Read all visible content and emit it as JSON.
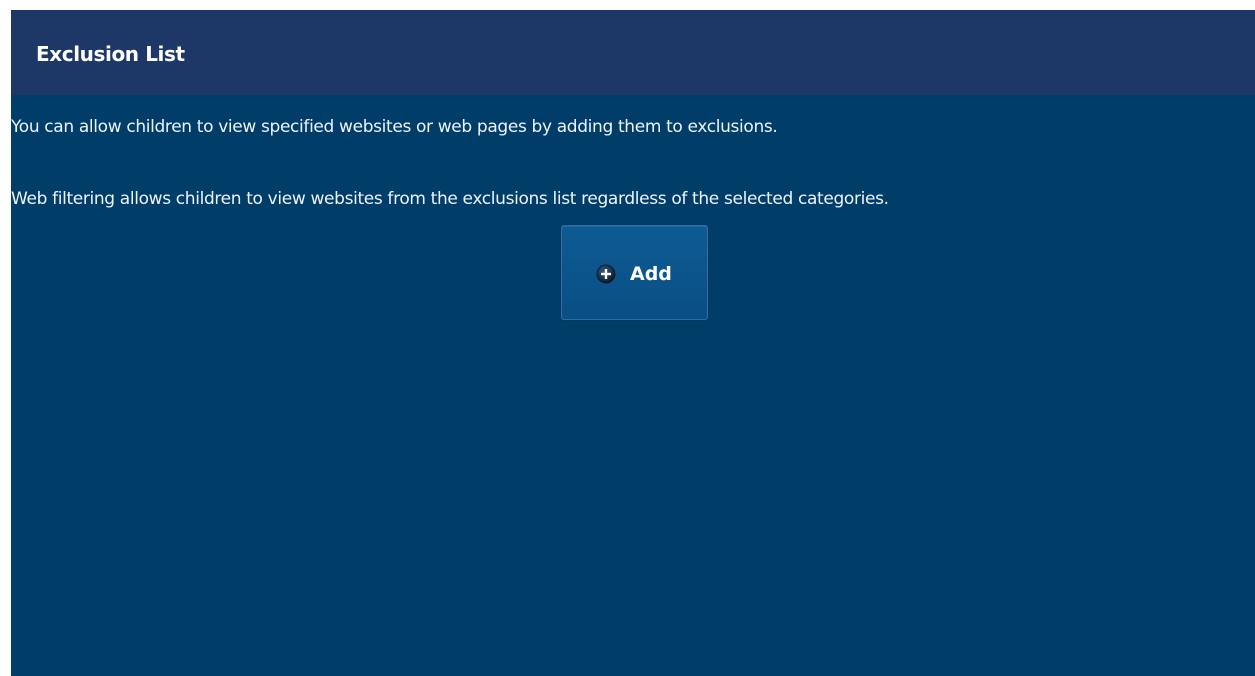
{
  "header": {
    "title": "Exclusion List"
  },
  "content": {
    "description_1": "You can allow children to view specified websites or web pages by adding them to exclusions.",
    "description_2": "Web filtering allows children to view websites from the exclusions list regardless of the selected categories."
  },
  "add_button": {
    "label": "Add",
    "icon": "plus-circle-icon"
  },
  "colors": {
    "header_background": "#1d3866",
    "page_background": "#003e69",
    "button_background": "#0a5287",
    "text": "#ffffff"
  }
}
